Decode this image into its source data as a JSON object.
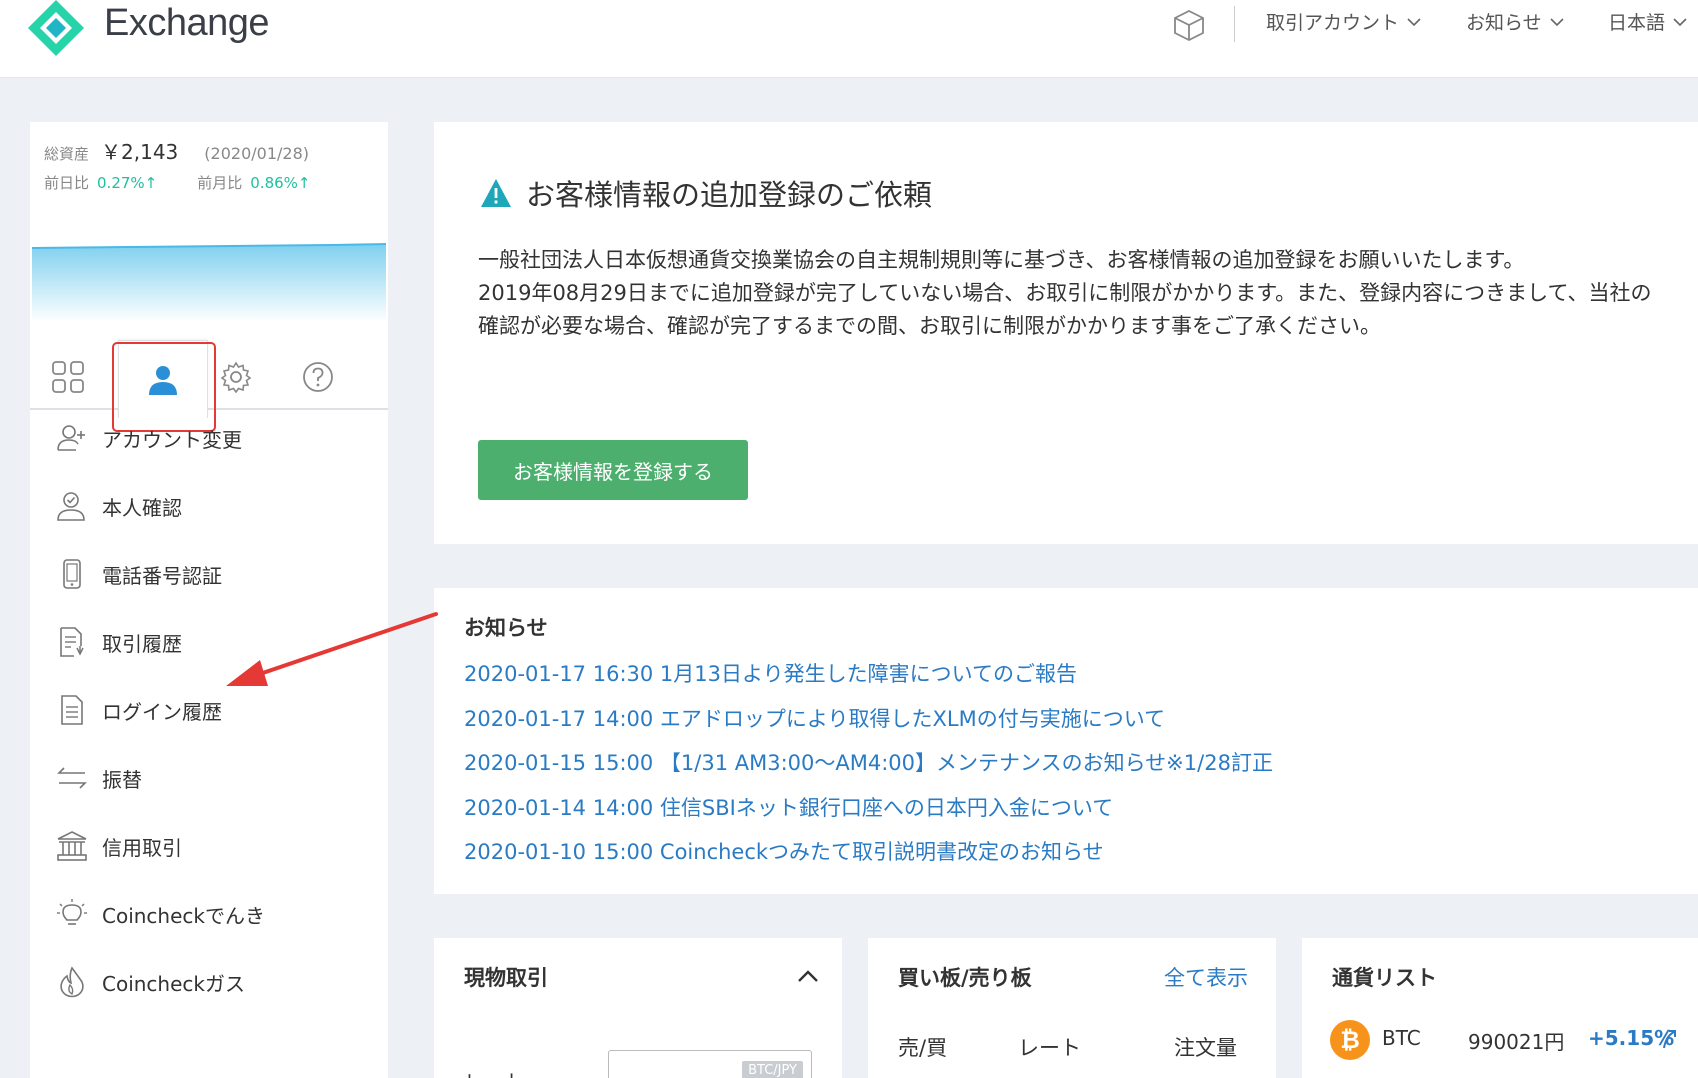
{
  "header": {
    "brand": "Exchange",
    "nav": [
      {
        "label": "取引アカウント"
      },
      {
        "label": "お知らせ"
      },
      {
        "label": "日本語"
      }
    ]
  },
  "sidebar": {
    "asset_label": "総資産",
    "asset_value": "￥2,143",
    "asset_date": "(2020/01/28)",
    "day_change_label": "前日比",
    "day_change_value": "0.27%↑",
    "month_change_label": "前月比",
    "month_change_value": "0.86%↑",
    "menu": [
      {
        "label": "アカウント変更",
        "icon": "add-user-icon"
      },
      {
        "label": "本人確認",
        "icon": "verified-user-icon"
      },
      {
        "label": "電話番号認証",
        "icon": "phone-icon"
      },
      {
        "label": "取引履歴",
        "icon": "history-document-icon"
      },
      {
        "label": "ログイン履歴",
        "icon": "document-icon"
      },
      {
        "label": "振替",
        "icon": "transfer-icon"
      },
      {
        "label": "信用取引",
        "icon": "bank-icon"
      },
      {
        "label": "Coincheckでんき",
        "icon": "lightbulb-icon"
      },
      {
        "label": "Coincheckガス",
        "icon": "flame-icon"
      }
    ]
  },
  "alert": {
    "title": "お客様情報の追加登録のご依頼",
    "line1": "一般社団法人日本仮想通貨交換業協会の自主規制規則等に基づき、お客様情報の追加登録をお願いいたします。",
    "line2": "2019年08月29日までに追加登録が完了していない場合、お取引に制限がかかります。また、登録内容につきまして、当社の確認が必要な場合、確認が完了するまでの間、お取引に制限がかかります事をご了承ください。",
    "button": "お客様情報を登録する"
  },
  "news": {
    "title": "お知らせ",
    "items": [
      "2020-01-17 16:30 1月13日より発生した障害についてのご報告",
      "2020-01-17 14:00 エアドロップにより取得したXLMの付与実施について",
      "2020-01-15 15:00 【1/31 AM3:00～AM4:00】メンテナンスのお知らせ※1/28訂正",
      "2020-01-14 14:00 住信SBIネット銀行口座への日本円入金について",
      "2020-01-10 15:00 Coincheckつみたて取引説明書改定のお知らせ"
    ]
  },
  "trade": {
    "title": "現物取引",
    "rate_label": "レート",
    "pair": "BTC/JPY"
  },
  "book": {
    "title": "買い板/売り板",
    "show_all": "全て表示",
    "col_side": "売/買",
    "col_rate": "レート",
    "col_amount": "注文量"
  },
  "coins": {
    "title": "通貨リスト",
    "items": [
      {
        "symbol": "BTC",
        "price": "990021円",
        "change": "+5.15%"
      }
    ]
  },
  "colors": {
    "accent_blue": "#2a7bc4",
    "green_button": "#4caf6e",
    "positive_teal": "#1fc0a0",
    "annotation_red": "#e53935",
    "btc_orange": "#f7931a"
  }
}
